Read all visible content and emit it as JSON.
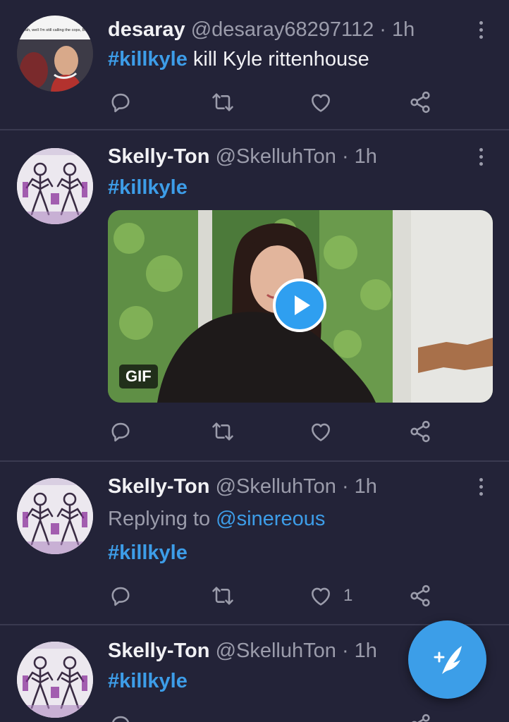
{
  "tweets": [
    {
      "name": "desaray",
      "handle": "@desaray68297112",
      "dot": "·",
      "time": "1h",
      "avatar_caption": "Yeah, well I'm still calling the cops, Bud",
      "hashtag": "#killkyle",
      "text": " kill Kyle rittenhouse"
    },
    {
      "name": "Skelly-Ton",
      "handle": "@SkelluhTon",
      "dot": "·",
      "time": "1h",
      "hashtag": "#killkyle",
      "media": {
        "badge": "GIF",
        "type": "gif"
      }
    },
    {
      "name": "Skelly-Ton",
      "handle": "@SkelluhTon",
      "dot": "·",
      "time": "1h",
      "reply_label": "Replying to ",
      "reply_to": "@sinereous",
      "hashtag": "#killkyle",
      "like_count": "1"
    },
    {
      "name": "Skelly-Ton",
      "handle": "@SkelluhTon",
      "dot": "·",
      "time": "1h",
      "hashtag": "#killkyle"
    }
  ],
  "icons": {
    "reply": "reply-icon",
    "retweet": "retweet-icon",
    "like": "heart-icon",
    "share": "share-icon",
    "more": "more-vertical-icon",
    "compose": "compose-tweet-icon",
    "play": "play-icon"
  },
  "colors": {
    "background": "#232338",
    "accent": "#3d9de8",
    "muted": "#9b9cab",
    "divider": "#3a3a50"
  }
}
